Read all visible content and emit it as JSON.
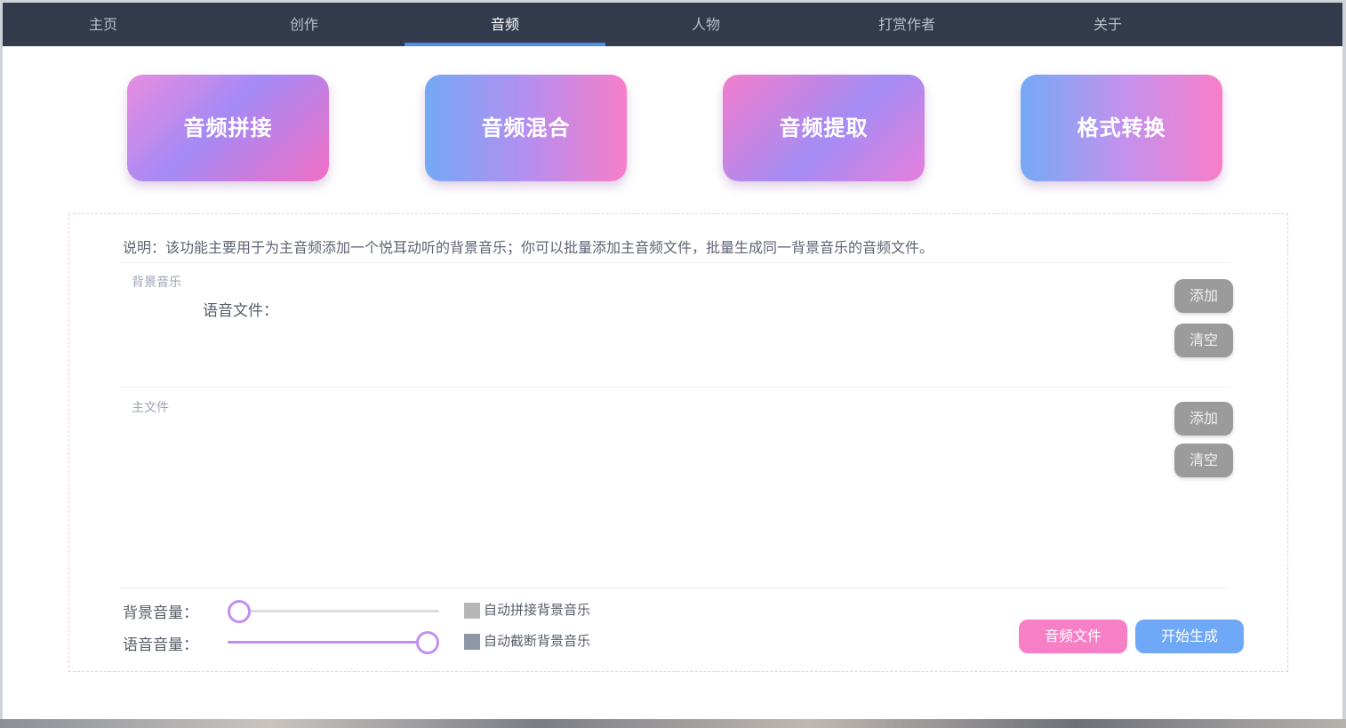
{
  "nav": {
    "items": [
      {
        "label": "主页"
      },
      {
        "label": "创作"
      },
      {
        "label": "音频"
      },
      {
        "label": "人物"
      },
      {
        "label": "打赏作者"
      },
      {
        "label": "关于"
      }
    ],
    "active_index": 2
  },
  "tools": [
    {
      "label": "音频拼接"
    },
    {
      "label": "音频混合"
    },
    {
      "label": "音频提取"
    },
    {
      "label": "格式转换"
    }
  ],
  "panel": {
    "description": "说明：该功能主要用于为主音频添加一个悦耳动听的背景音乐；你可以批量添加主音频文件，批量生成同一背景音乐的音频文件。",
    "bg_music": {
      "section_label": "背景音乐",
      "voice_file_label": "语音文件：",
      "add_label": "添加",
      "clear_label": "清空"
    },
    "main_file": {
      "section_label": "主文件",
      "add_label": "添加",
      "clear_label": "清空"
    },
    "bg_volume": {
      "label": "背景音量：",
      "value": 0.0
    },
    "voice_volume": {
      "label": "语音音量：",
      "value": 1.0
    },
    "auto_splice_label": "自动拼接背景音乐",
    "auto_cut_label": "自动截断背景音乐",
    "audio_file_button": "音频文件",
    "start_button": "开始生成"
  },
  "colors": {
    "nav_bg": "#323a4b",
    "nav_active_underline": "#4a8df0",
    "slider_accent": "#c28ef0",
    "pink_button": "#f77fc6",
    "blue_button": "#6ea8f7"
  }
}
